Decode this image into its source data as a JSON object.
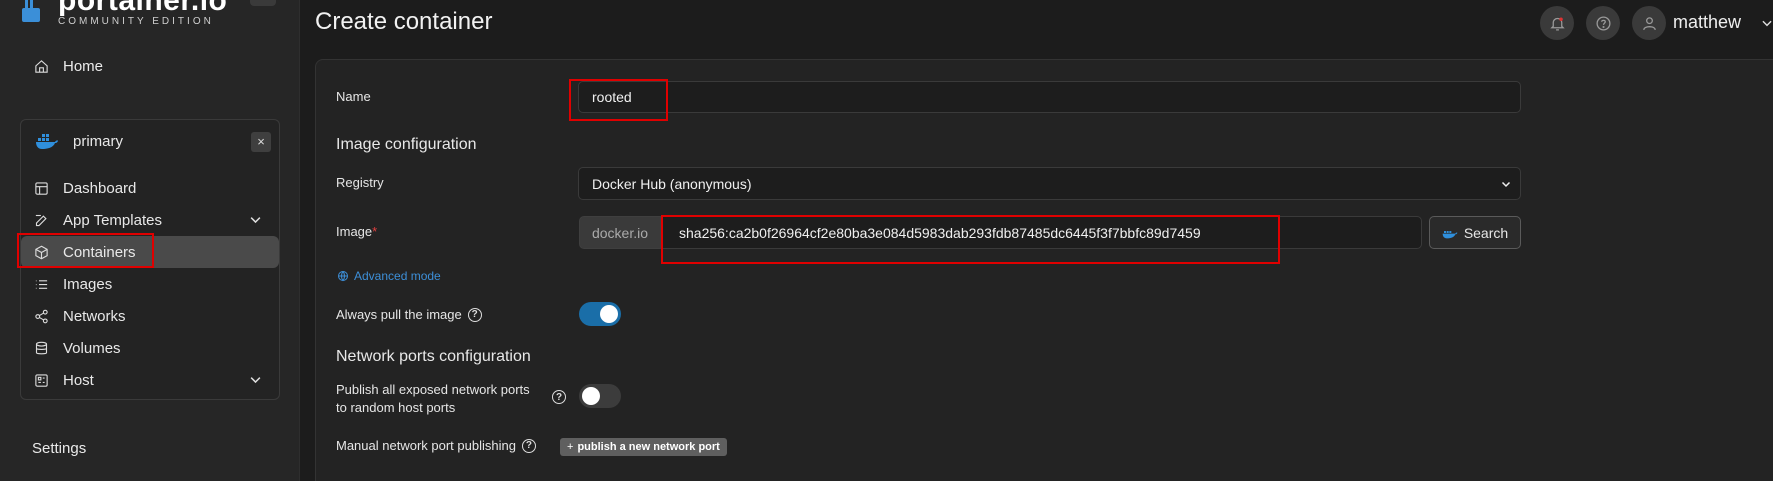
{
  "brand": {
    "name": "portainer.io",
    "edition": "COMMUNITY EDITION"
  },
  "sidebar": {
    "home": "Home",
    "environment": {
      "name": "primary",
      "close": "×",
      "items": [
        {
          "label": "Dashboard",
          "icon": "dashboard-icon"
        },
        {
          "label": "App Templates",
          "icon": "edit-icon"
        },
        {
          "label": "Containers",
          "icon": "box-icon"
        },
        {
          "label": "Images",
          "icon": "list-icon"
        },
        {
          "label": "Networks",
          "icon": "share-icon"
        },
        {
          "label": "Volumes",
          "icon": "database-icon"
        },
        {
          "label": "Host",
          "icon": "host-icon"
        }
      ]
    },
    "settings": "Settings"
  },
  "header": {
    "title": "Create container",
    "user": "matthew"
  },
  "form": {
    "name_label": "Name",
    "name_value": "rooted",
    "image_config_title": "Image configuration",
    "registry_label": "Registry",
    "registry_value": "Docker Hub (anonymous)",
    "image_label": "Image",
    "image_required": "*",
    "image_prefix": "docker.io",
    "image_value": "sha256:ca2b0f26964cf2e80ba3e084d5983dab293fdb87485dc6445f3f7bbfc89d7459",
    "search_label": "Search",
    "advanced_mode": "Advanced mode",
    "always_pull_label": "Always pull the image",
    "always_pull_on": true,
    "network_title": "Network ports configuration",
    "publish_all_label_1": "Publish all exposed network ports",
    "publish_all_label_2": "to random host ports",
    "publish_all_on": false,
    "manual_publish_label": "Manual network port publishing",
    "publish_new_port": "publish a new network port"
  },
  "colors": {
    "accent": "#3d8fd8",
    "toggle_on": "#1a6ea8",
    "highlight": "#e00000"
  }
}
